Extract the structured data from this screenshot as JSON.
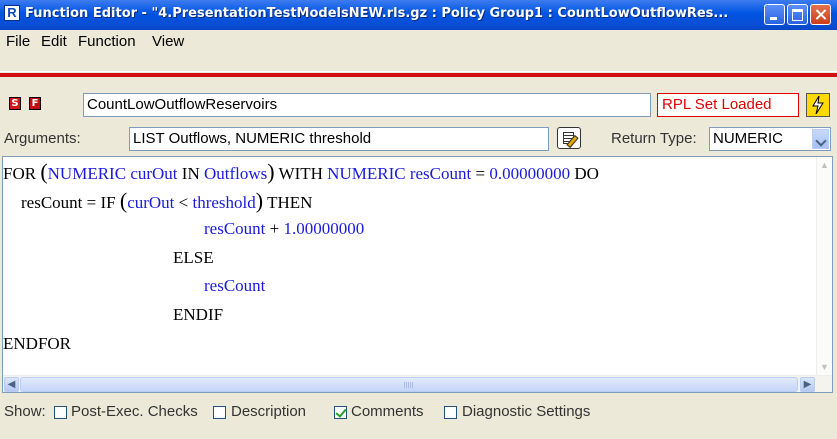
{
  "window": {
    "title": "Function Editor - \"4.PresentationTestModelsNEW.rls.gz : Policy Group1 : CountLowOutflowRes...",
    "icon_letter": "R"
  },
  "menu": [
    "File",
    "Edit",
    "Function",
    "View"
  ],
  "header": {
    "badge_s": "S",
    "badge_f": "F",
    "function_name": "CountLowOutflowReservoirs",
    "rpl_status": "RPL Set Loaded",
    "bolt_icon": "lightning-icon"
  },
  "arguments": {
    "label": "Arguments:",
    "value": "LIST Outflows, NUMERIC threshold",
    "return_label": "Return Type:",
    "return_value": "NUMERIC"
  },
  "code": {
    "l1": {
      "for": "FOR",
      "p1": "(",
      "numeric1": "NUMERIC",
      "curout": "curOut",
      "in": "IN",
      "outflows": "Outflows",
      "p2": ")",
      "with": "WITH",
      "numeric2": "NUMERIC",
      "rescount": "resCount",
      "eq": "=",
      "zero": "0.00000000",
      "do": "DO"
    },
    "l2": {
      "rescount": "resCount",
      "eq": "=",
      "if": "IF",
      "p1": "(",
      "curout": "curOut",
      "lt": "<",
      "threshold": "threshold",
      "p2": ")",
      "then": "THEN"
    },
    "l3": {
      "rescount": "resCount",
      "plus": "+",
      "one": "1.00000000"
    },
    "l4": {
      "else": "ELSE"
    },
    "l5": {
      "rescount": "resCount"
    },
    "l6": {
      "endif": "ENDIF"
    },
    "l7": {
      "endfor": "ENDFOR"
    }
  },
  "show": {
    "label": "Show:",
    "options": [
      {
        "label": "Post-Exec. Checks",
        "checked": false
      },
      {
        "label": "Description",
        "checked": false
      },
      {
        "label": "Comments",
        "checked": true
      },
      {
        "label": "Diagnostic Settings",
        "checked": false
      }
    ]
  }
}
